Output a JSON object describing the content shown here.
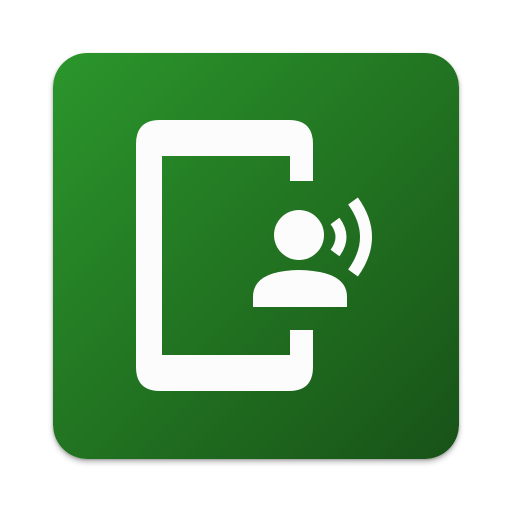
{
  "icon": {
    "name": "phone-with-speaking-person-icon",
    "gradient_start": "#2B962B",
    "gradient_end": "#185218",
    "glyph_color": "#FCFCFC"
  }
}
